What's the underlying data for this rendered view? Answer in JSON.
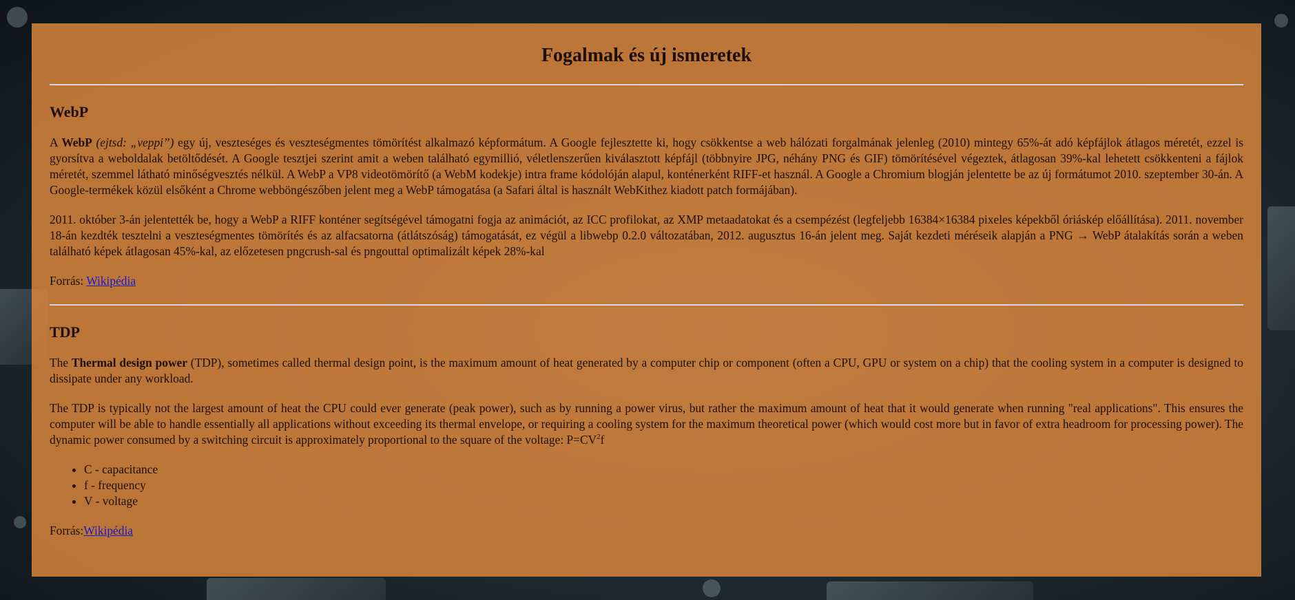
{
  "page_title": "Fogalmak és új ismeretek",
  "webp": {
    "heading": "WebP",
    "p1_pre": "A ",
    "p1_bold": "WebP",
    "p1_ital": " (ejtsd: „veppi”)",
    "p1_rest": " egy új, veszteséges és veszteségmentes tömörítést alkalmazó képformátum. A Google fejlesztette ki, hogy csökkentse a web hálózati forgalmának jelenleg (2010) mintegy 65%-át adó képfájlok átlagos méretét, ezzel is gyorsítva a weboldalak betöltődését. A Google tesztjei szerint amit a weben található egymillió, véletlenszerűen kiválasztott képfájl (többnyire JPG, néhány PNG és GIF) tömörítésével végeztek, átlagosan 39%-kal lehetett csökkenteni a fájlok méretét, szemmel látható minőségvesztés nélkül. A WebP a VP8 videotömörítő (a WebM kodekje) intra frame kódolóján alapul, konténerként RIFF-et használ. A Google a Chromium blogján jelentette be az új formátumot 2010. szeptember 30-án. A Google-termékek közül elsőként a Chrome webböngészőben jelent meg a WebP támogatása (a Safari által is használt WebKithez kiadott patch formájában).",
    "p2": "2011. október 3-án jelentették be, hogy a WebP a RIFF konténer segítségével támogatni fogja az animációt, az ICC profilokat, az XMP metaadatokat és a csempézést (legfeljebb 16384×16384 pixeles képekből óriáskép előállítása). 2011. november 18-án kezdték tesztelni a veszteségmentes tömörítés és az alfacsatorna (átlátszóság) támogatását, ez végül a libwebp 0.2.0 változatában, 2012. augusztus 16-án jelent meg. Saját kezdeti méréseik alapján a PNG → WebP átalakítás során a weben található képek átlagosan 45%-kal, az előzetesen pngcrush-sal és pngouttal optimalizált képek 28%-kal",
    "source_label": "Forrás: ",
    "source_link": "Wikipédia"
  },
  "tdp": {
    "heading": "TDP",
    "p1_pre": "The ",
    "p1_bold": "Thermal design power",
    "p1_rest": " (TDP), sometimes called thermal design point, is the maximum amount of heat generated by a computer chip or component (often a CPU, GPU or system on a chip) that the cooling system in a computer is designed to dissipate under any workload.",
    "p2": "The TDP is typically not the largest amount of heat the CPU could ever generate (peak power), such as by running a power virus, but rather the maximum amount of heat that it would generate when running \"real applications\". This ensures the computer will be able to handle essentially all applications without exceeding its thermal envelope, or requiring a cooling system for the maximum theoretical power (which would cost more but in favor of extra headroom for processing power). The dynamic power consumed by a switching circuit is approximately proportional to the square of the voltage: P=CV",
    "p2_sup": "2",
    "p2_end": "f",
    "list": [
      "C - capacitance",
      "f - frequency",
      "V - voltage"
    ],
    "source_label": "Forrás:",
    "source_link": "Wikipédia"
  }
}
